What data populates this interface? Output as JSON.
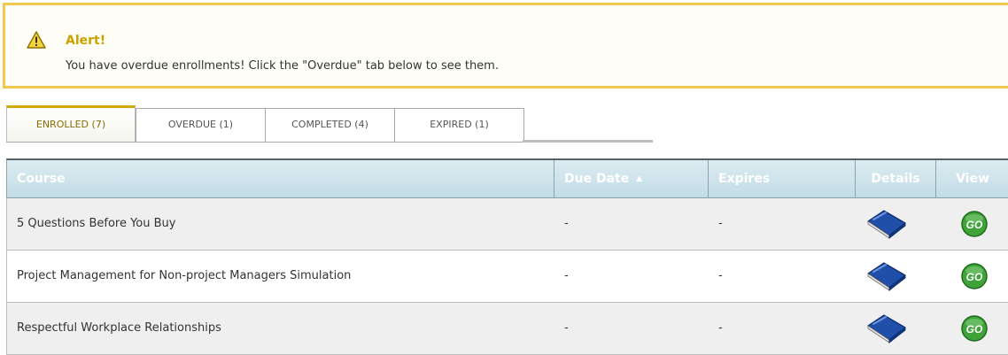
{
  "alert": {
    "icon": "warning-triangle-icon",
    "title": "Alert!",
    "message": "You have overdue enrollments! Click the \"Overdue\" tab below to see them.",
    "border_color": "#f2c94c",
    "title_color": "#c9a100"
  },
  "tabs": [
    {
      "label": "ENROLLED (7)",
      "active": true
    },
    {
      "label": "OVERDUE (1)",
      "active": false
    },
    {
      "label": "COMPLETED (4)",
      "active": false
    },
    {
      "label": "EXPIRED (1)",
      "active": false
    }
  ],
  "table": {
    "columns": {
      "course": "Course",
      "due_date": "Due Date",
      "expires": "Expires",
      "details": "Details",
      "view": "View"
    },
    "sort_column": "due_date",
    "sort_direction": "ascending",
    "rows": [
      {
        "course": "5 Questions Before You Buy",
        "due_date": "-",
        "expires": "-",
        "details_icon": "book-icon",
        "view_icon": "go-button-icon"
      },
      {
        "course": "Project Management for Non-project Managers Simulation",
        "due_date": "-",
        "expires": "-",
        "details_icon": "book-icon",
        "view_icon": "go-button-icon"
      },
      {
        "course": "Respectful Workplace Relationships",
        "due_date": "-",
        "expires": "-",
        "details_icon": "book-icon",
        "view_icon": "go-button-icon"
      }
    ]
  },
  "colors": {
    "header_gradient_top": "#dcebf1",
    "header_gradient_bottom": "#c2dce6",
    "row_odd": "#efefef",
    "row_even": "#ffffff",
    "active_tab_accent": "#d4a800",
    "go_button": "#3fa33a",
    "book": "#1f4fa8"
  }
}
